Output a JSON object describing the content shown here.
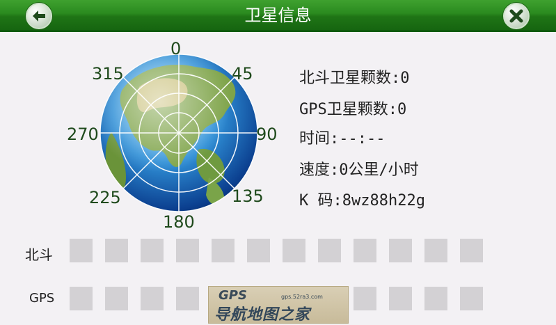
{
  "header": {
    "title": "卫星信息",
    "back_icon": "back-arrow-icon",
    "close_icon": "close-icon"
  },
  "compass": {
    "labels": [
      "0",
      "45",
      "90",
      "135",
      "180",
      "225",
      "270",
      "315"
    ]
  },
  "info": {
    "beidou_count": "北斗卫星颗数:0",
    "gps_count": "GPS卫星颗数:0",
    "time": "时间:--:--",
    "speed": "速度:0公里/小时",
    "k_code": "K 码:8wz88h22g"
  },
  "signal_rows": {
    "beidou_label": "北斗",
    "gps_label": "GPS"
  },
  "watermark": {
    "logo": "GPS",
    "url": "gps.52ra3.com",
    "name": "导航地图之家"
  },
  "colors": {
    "title_bar": "#2a8a1f",
    "slot": "#d3d1d4",
    "degree_label": "#1f4a1c"
  }
}
